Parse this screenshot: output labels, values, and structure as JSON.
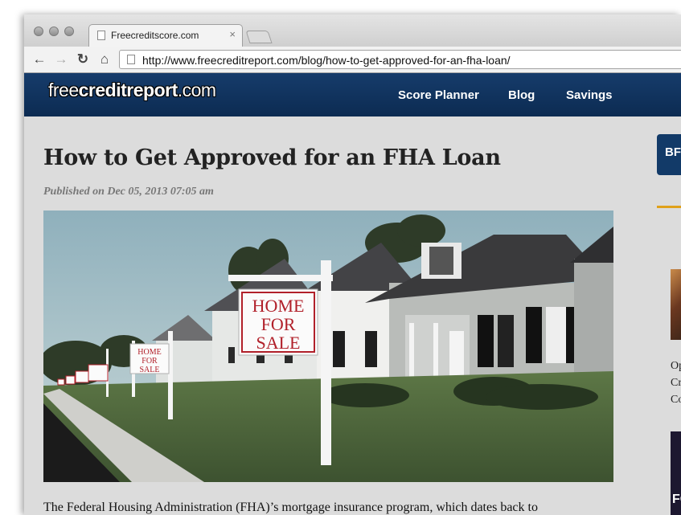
{
  "browser": {
    "tab_title": "Freecreditscore.com",
    "tab_close": "×",
    "url": "http://www.freecreditreport.com/blog/how-to-get-approved-for-an-fha-loan/",
    "back_glyph": "←",
    "forward_glyph": "→",
    "reload_glyph": "↻",
    "home_glyph": "⌂"
  },
  "site": {
    "logo": {
      "part1": "free",
      "part2": "creditreport",
      "part3": ".com"
    },
    "nav": [
      "Score Planner",
      "Blog",
      "Savings"
    ],
    "brand_color": "#0f3360"
  },
  "article": {
    "title": "How to Get Approved for an FHA Loan",
    "published": "Published on Dec 05, 2013 07:05 am",
    "image_signs": {
      "big": [
        "HOME",
        "FOR",
        "SALE"
      ],
      "medium": [
        "HOME",
        "FOR",
        "SALE"
      ]
    },
    "body_first_line": "The Federal Housing Administration (FHA)’s mortgage insurance program, which dates back to"
  },
  "sidebar": {
    "button_text": "BF",
    "item1_lines": [
      "Op",
      "Cr",
      "Co"
    ],
    "item2_thumb_text": "FO"
  }
}
